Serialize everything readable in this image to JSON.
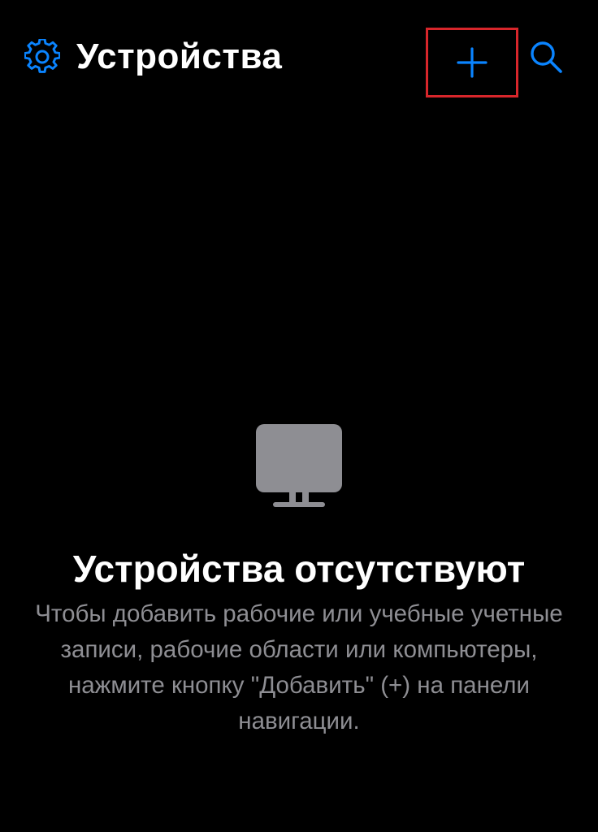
{
  "nav": {
    "title": "Устройства",
    "settings_icon": "gear-icon",
    "add_icon": "plus-icon",
    "search_icon": "search-icon"
  },
  "empty_state": {
    "icon": "monitor-icon",
    "title": "Устройства отсутствуют",
    "description": "Чтобы добавить рабочие или учебные учетные записи, рабочие области или компьютеры, нажмите кнопку \"Добавить\" (+) на панели навигации."
  },
  "colors": {
    "background": "#000000",
    "accent": "#0a84ff",
    "highlight": "#d8262b",
    "icon_gray": "#8e8e93",
    "text_secondary": "#8e8e93"
  }
}
